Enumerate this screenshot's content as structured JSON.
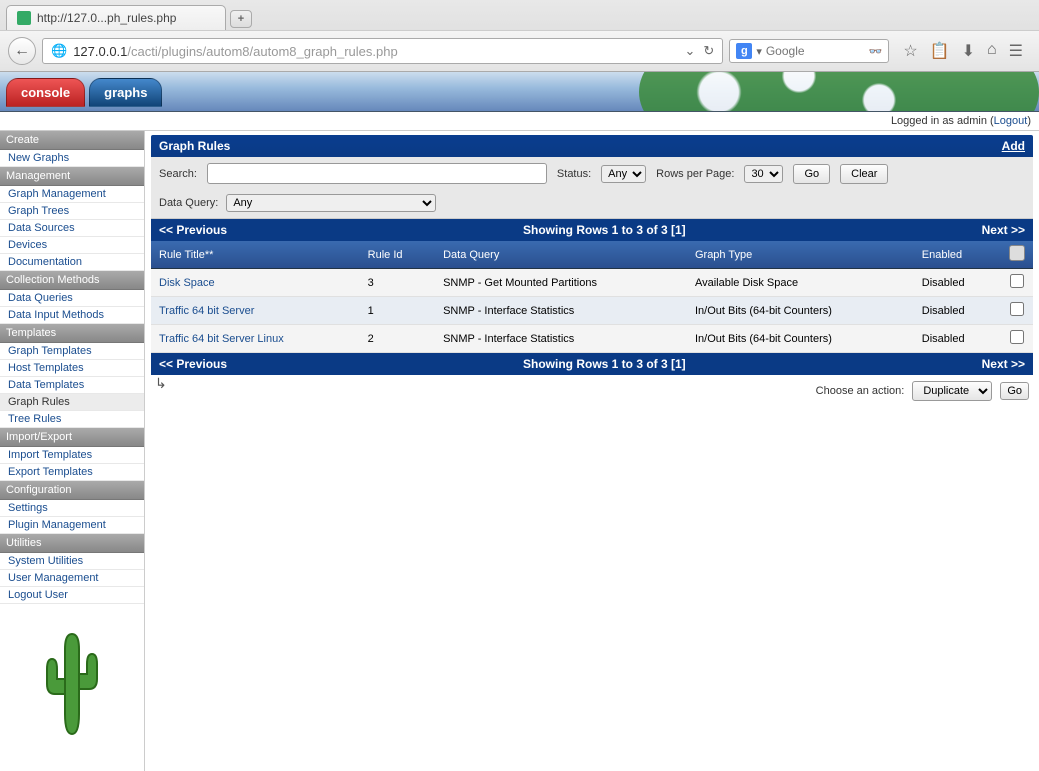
{
  "browser": {
    "tab_title": "http://127.0...ph_rules.php",
    "url_host": "127.0.0.1",
    "url_path": "/cacti/plugins/autom8/autom8_graph_rules.php",
    "search_placeholder": "Google"
  },
  "header": {
    "tab_console": "console",
    "tab_graphs": "graphs",
    "login_text": "Logged in as admin (",
    "logout": "Logout",
    "login_close": ")"
  },
  "sidebar": {
    "sections": [
      {
        "title": "Create",
        "items": [
          "New Graphs"
        ]
      },
      {
        "title": "Management",
        "items": [
          "Graph Management",
          "Graph Trees",
          "Data Sources",
          "Devices",
          "Documentation"
        ]
      },
      {
        "title": "Collection Methods",
        "items": [
          "Data Queries",
          "Data Input Methods"
        ]
      },
      {
        "title": "Templates",
        "items": [
          "Graph Templates",
          "Host Templates",
          "Data Templates",
          "Graph Rules",
          "Tree Rules"
        ]
      },
      {
        "title": "Import/Export",
        "items": [
          "Import Templates",
          "Export Templates"
        ]
      },
      {
        "title": "Configuration",
        "items": [
          "Settings",
          "Plugin Management"
        ]
      },
      {
        "title": "Utilities",
        "items": [
          "System Utilities",
          "User Management",
          "Logout User"
        ]
      }
    ],
    "active": "Graph Rules"
  },
  "panel": {
    "title": "Graph Rules",
    "add": "Add",
    "search_label": "Search:",
    "status_label": "Status:",
    "status_value": "Any",
    "rows_label": "Rows per Page:",
    "rows_value": "30",
    "go": "Go",
    "clear": "Clear",
    "dataquery_label": "Data Query:",
    "dataquery_value": "Any"
  },
  "pager": {
    "prev": "<< Previous",
    "middle": "Showing Rows 1 to 3 of 3 [1]",
    "next": "Next >>"
  },
  "table": {
    "headers": [
      "Rule Title**",
      "Rule Id",
      "Data Query",
      "Graph Type",
      "Enabled"
    ],
    "rows": [
      {
        "title": "Disk Space",
        "id": "3",
        "query": "SNMP - Get Mounted Partitions",
        "type": "Available Disk Space",
        "enabled": "Disabled"
      },
      {
        "title": "Traffic 64 bit Server",
        "id": "1",
        "query": "SNMP - Interface Statistics",
        "type": "In/Out Bits (64-bit Counters)",
        "enabled": "Disabled"
      },
      {
        "title": "Traffic 64 bit Server Linux",
        "id": "2",
        "query": "SNMP - Interface Statistics",
        "type": "In/Out Bits (64-bit Counters)",
        "enabled": "Disabled"
      }
    ]
  },
  "action": {
    "label": "Choose an action:",
    "value": "Duplicate",
    "go": "Go"
  }
}
